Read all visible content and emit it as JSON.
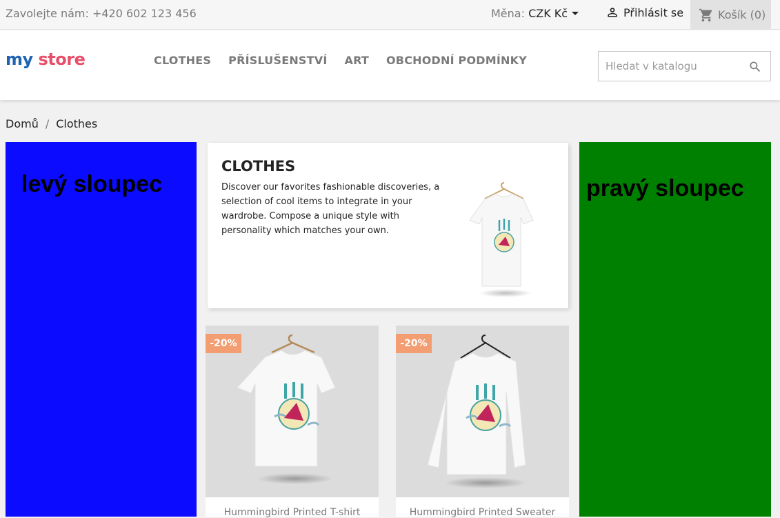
{
  "topbar": {
    "contact": "Zavolejte nám: +420 602 123 456",
    "currency_label": "Měna:",
    "currency_value": "CZK Kč",
    "login": "Přihlásit se",
    "cart": "Košík (0)"
  },
  "header": {
    "logo_my": "my",
    "logo_store": "store",
    "nav": [
      "CLOTHES",
      "PŘÍSLUŠENSTVÍ",
      "ART",
      "OBCHODNÍ PODMÍNKY"
    ],
    "search_placeholder": "Hledat v katalogu"
  },
  "breadcrumb": [
    "Domů",
    "Clothes"
  ],
  "left_column": {
    "title": "levý sloupec"
  },
  "right_column": {
    "title": "pravý sloupec"
  },
  "category": {
    "title": "CLOTHES",
    "description": "Discover our favorites fashionable discoveries, a selection of cool items to integrate in your wardrobe. Compose a unique style with personality which matches your own."
  },
  "products": [
    {
      "name": "Hummingbird Printed T-shirt",
      "discount": "-20%"
    },
    {
      "name": "Hummingbird Printed Sweater",
      "discount": "-20%"
    }
  ],
  "colors": {
    "left_column": "#0b0bff",
    "right_column": "#008000",
    "discount_badge": "#f39d72"
  }
}
